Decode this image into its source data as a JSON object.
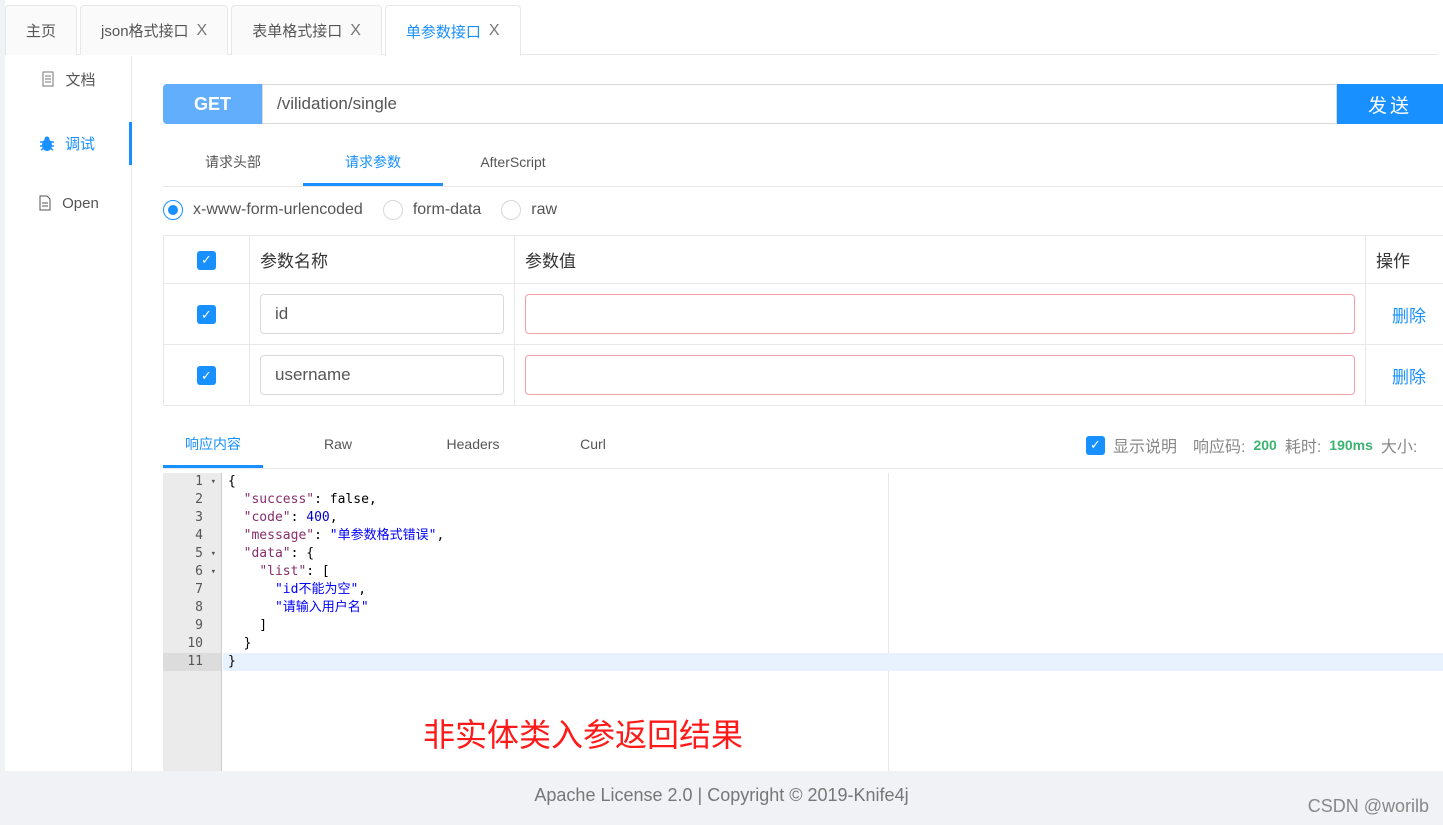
{
  "tabs": [
    {
      "label": "主页",
      "closable": false
    },
    {
      "label": "json格式接口",
      "closable": true
    },
    {
      "label": "表单格式接口",
      "closable": true
    },
    {
      "label": "单参数接口",
      "closable": true,
      "active": true
    }
  ],
  "close_glyph": "X",
  "sidebar": {
    "items": [
      {
        "label": "文档",
        "icon": "document-icon"
      },
      {
        "label": "调试",
        "icon": "bug-icon",
        "active": true
      },
      {
        "label": "Open",
        "icon": "file-icon"
      }
    ]
  },
  "request": {
    "method": "GET",
    "url": "/vilidation/single",
    "send_label": "发送"
  },
  "request_tabs": [
    "请求头部",
    "请求参数",
    "AfterScript"
  ],
  "body_types": [
    {
      "label": "x-www-form-urlencoded",
      "selected": true
    },
    {
      "label": "form-data",
      "selected": false
    },
    {
      "label": "raw",
      "selected": false
    }
  ],
  "params_table": {
    "headers": [
      "参数名称",
      "参数值",
      "操作"
    ],
    "rows": [
      {
        "checked": true,
        "name": "id",
        "value": "",
        "action": "删除"
      },
      {
        "checked": true,
        "name": "username",
        "value": "",
        "action": "删除"
      }
    ]
  },
  "response_tabs": [
    "响应内容",
    "Raw",
    "Headers",
    "Curl"
  ],
  "response_status": {
    "show_desc_label": "显示说明",
    "show_desc_checked": true,
    "code_label": "响应码:",
    "code": "200",
    "time_label": "耗时:",
    "time": "190ms",
    "size_label": "大小:"
  },
  "response_body": {
    "success": "false",
    "code": "400",
    "message": "单参数格式错误",
    "list": [
      "id不能为空",
      "请输入用户名"
    ]
  },
  "annotation": "非实体类入参返回结果",
  "footer": "Apache License 2.0 | Copyright © 2019-Knife4j",
  "watermark": "CSDN @worilb",
  "colors": {
    "accent": "#1890ff",
    "method_bg": "#62aefc",
    "success": "#3cb371",
    "annotation": "#ff1a1a"
  }
}
